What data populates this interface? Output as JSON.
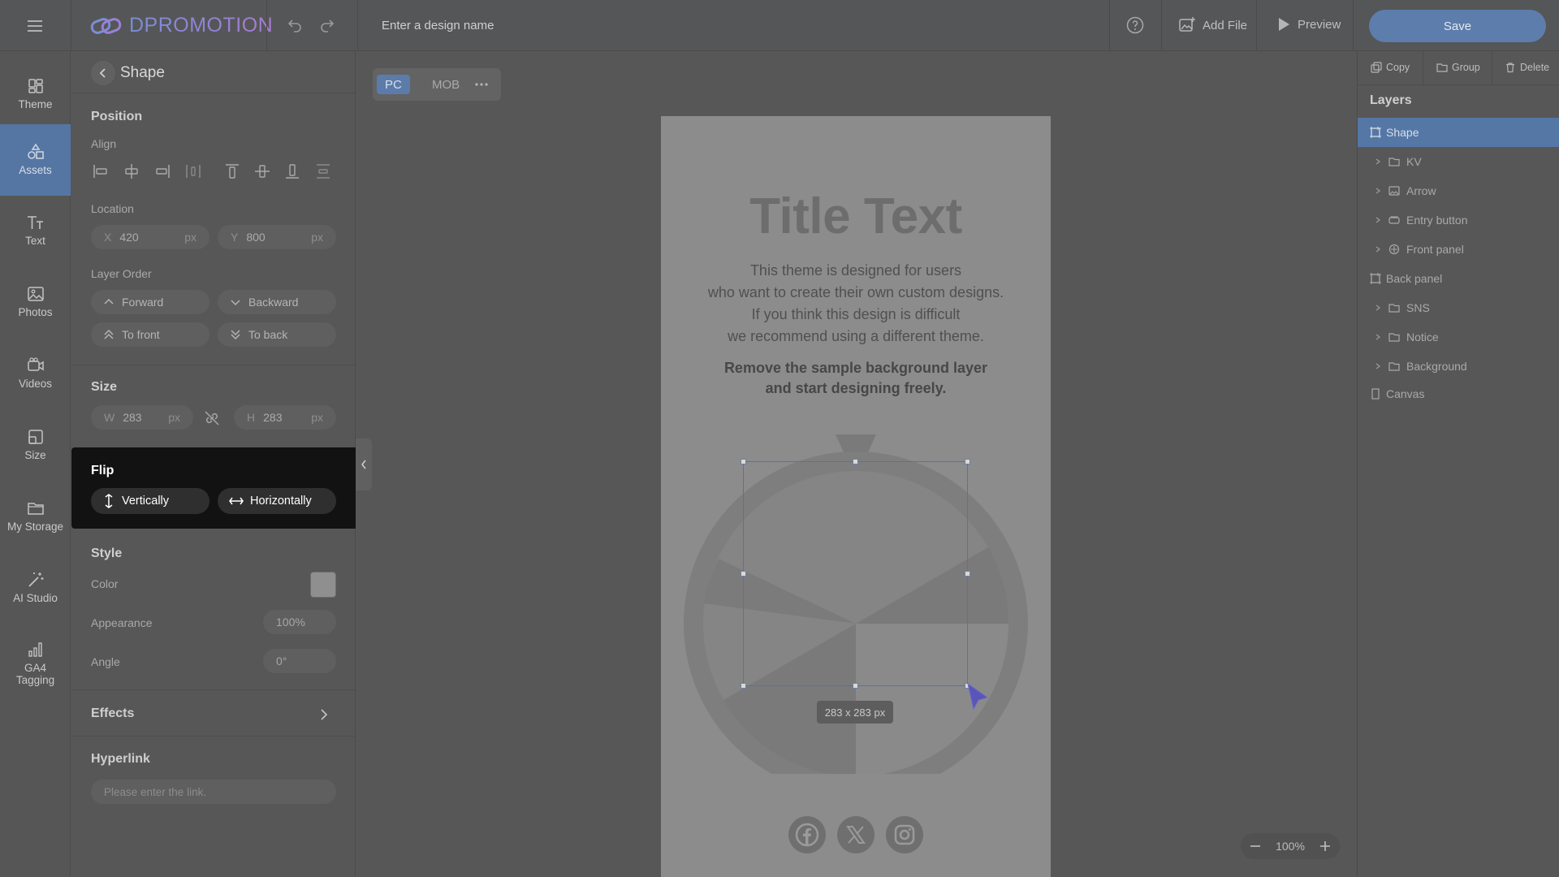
{
  "app": {
    "brand": "DPROMOTION",
    "design_name_placeholder": "Enter a design name",
    "add_file_label": "Add File",
    "preview_label": "Preview",
    "save_label": "Save"
  },
  "rail": {
    "items": [
      {
        "label": "Theme",
        "icon": "theme-icon",
        "active": false
      },
      {
        "label": "Assets",
        "icon": "assets-icon",
        "active": true
      },
      {
        "label": "Text",
        "icon": "text-icon",
        "active": false
      },
      {
        "label": "Photos",
        "icon": "photos-icon",
        "active": false
      },
      {
        "label": "Videos",
        "icon": "videos-icon",
        "active": false
      },
      {
        "label": "Size",
        "icon": "size-icon",
        "active": false
      },
      {
        "label": "My Storage",
        "icon": "folder-icon",
        "active": false
      },
      {
        "label": "AI Studio",
        "icon": "magic-wand-icon",
        "active": false
      },
      {
        "label": "GA4 Tagging",
        "icon": "bar-chart-icon",
        "active": false
      }
    ]
  },
  "panel": {
    "title": "Shape",
    "position": {
      "title": "Position",
      "align_label": "Align",
      "location_label": "Location",
      "x_key": "X",
      "x_value": "420",
      "x_unit": "px",
      "y_key": "Y",
      "y_value": "800",
      "y_unit": "px",
      "layer_order_label": "Layer Order",
      "forward": "Forward",
      "backward": "Backward",
      "to_front": "To front",
      "to_back": "To back"
    },
    "size": {
      "title": "Size",
      "w_key": "W",
      "w_value": "283",
      "w_unit": "px",
      "h_key": "H",
      "h_value": "283",
      "h_unit": "px"
    },
    "flip": {
      "title": "Flip",
      "vertically": "Vertically",
      "horizontally": "Horizontally"
    },
    "style": {
      "title": "Style",
      "color_label": "Color",
      "color_value": "#8f8f8f",
      "appearance_label": "Appearance",
      "appearance_value": "100%",
      "angle_label": "Angle",
      "angle_value": "0°"
    },
    "effects_title": "Effects",
    "hyperlink": {
      "title": "Hyperlink",
      "placeholder": "Please enter the link."
    }
  },
  "device_tabs": {
    "pc": "PC",
    "mob": "MOB",
    "active": "PC"
  },
  "canvas": {
    "title": "Title Text",
    "body_lines": [
      "This theme is designed for users",
      "who want to create their own custom designs.",
      "If you think this design is difficult",
      "we recommend using a different theme."
    ],
    "bold_lines": [
      "Remove the sample background layer",
      "and start designing freely."
    ],
    "size_tag": "283 x 283 px",
    "social": [
      "facebook-icon",
      "x-icon",
      "instagram-icon"
    ]
  },
  "zoom": {
    "value": "100%"
  },
  "layers": {
    "copy": "Copy",
    "group": "Group",
    "delete": "Delete",
    "title": "Layers",
    "items": [
      {
        "label": "Shape",
        "icon": "shape-icon",
        "expandable": false,
        "selected": true
      },
      {
        "label": "KV",
        "icon": "folder-icon",
        "expandable": true,
        "selected": false
      },
      {
        "label": "Arrow",
        "icon": "image-icon",
        "expandable": true,
        "selected": false
      },
      {
        "label": "Entry button",
        "icon": "button-icon",
        "expandable": true,
        "selected": false
      },
      {
        "label": "Front panel",
        "icon": "component-icon",
        "expandable": true,
        "selected": false
      },
      {
        "label": "Back panel",
        "icon": "shape-icon",
        "expandable": false,
        "selected": false
      },
      {
        "label": "SNS",
        "icon": "folder-icon",
        "expandable": true,
        "selected": false
      },
      {
        "label": "Notice",
        "icon": "folder-icon",
        "expandable": true,
        "selected": false
      },
      {
        "label": "Background",
        "icon": "folder-icon",
        "expandable": true,
        "selected": false
      },
      {
        "label": "Canvas",
        "icon": "page-icon",
        "expandable": false,
        "selected": false
      }
    ]
  }
}
